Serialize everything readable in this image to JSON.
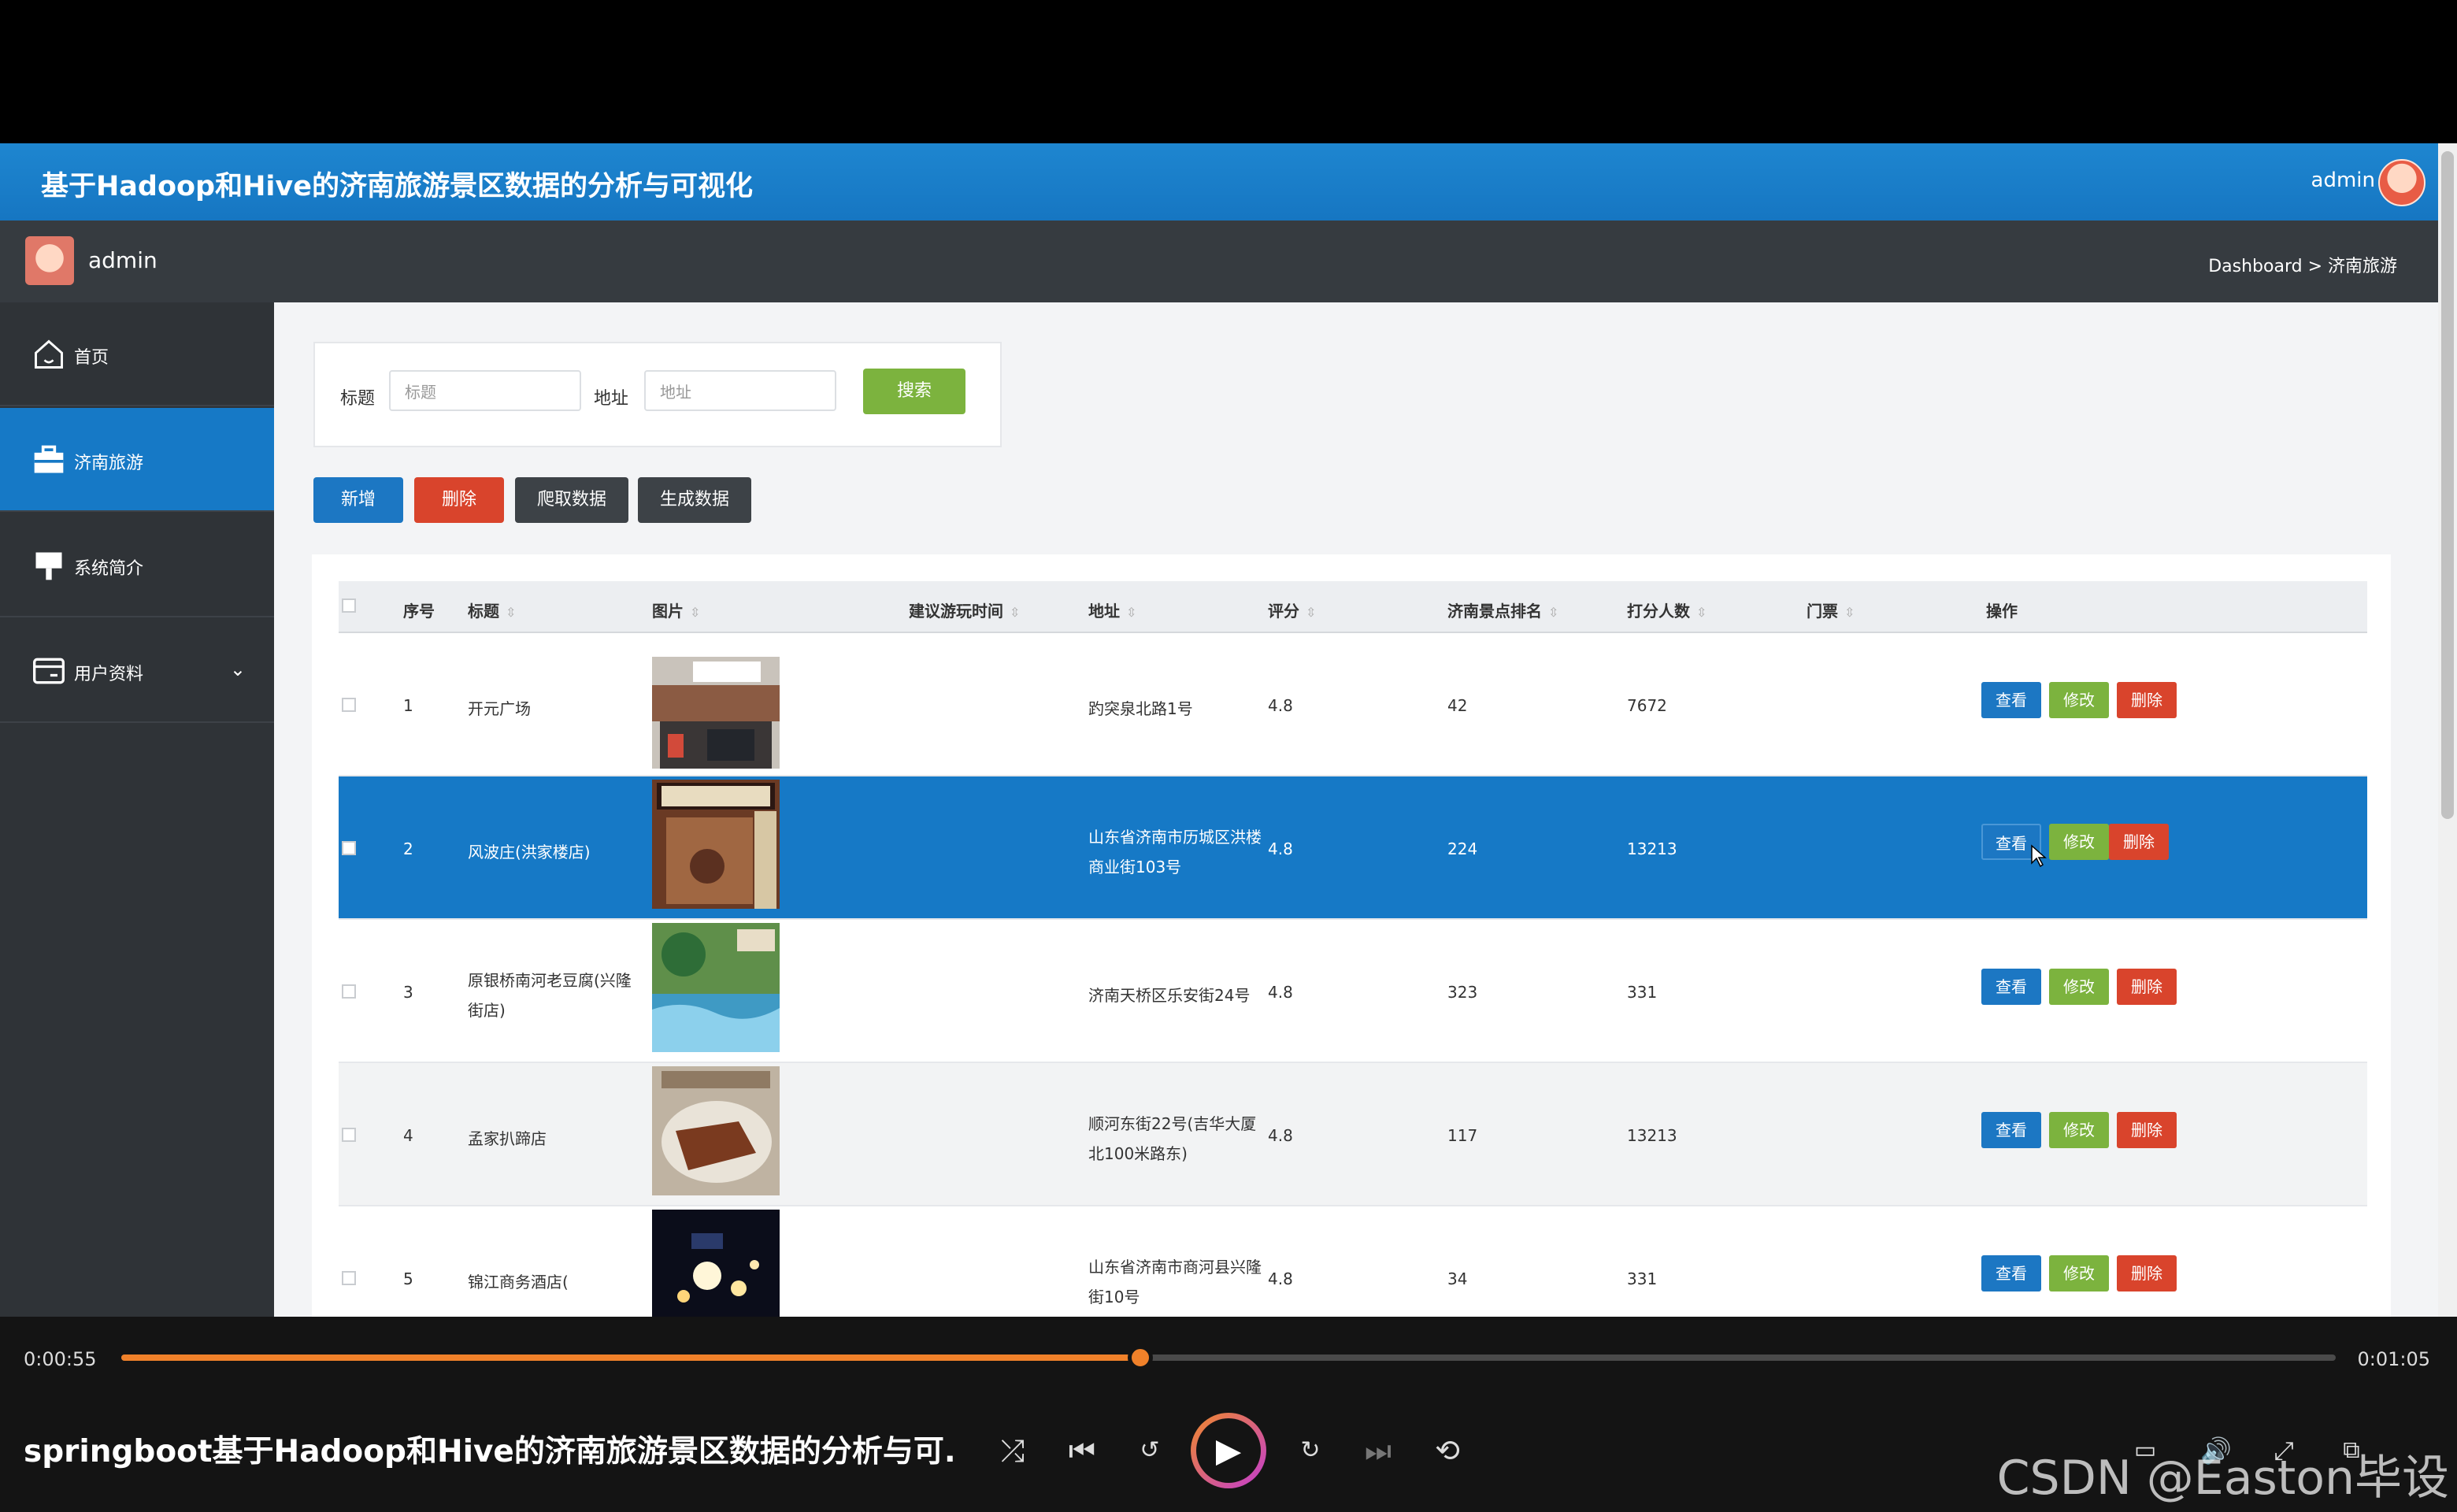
{
  "header": {
    "title": "基于Hadoop和Hive的济南旅游景区数据的分析与可视化",
    "user": "admin"
  },
  "subbar": {
    "user": "admin",
    "breadcrumb": "Dashboard > 济南旅游"
  },
  "sidebar": {
    "items": [
      {
        "label": "首页",
        "icon": "home-icon"
      },
      {
        "label": "济南旅游",
        "icon": "briefcase-icon",
        "active": true
      },
      {
        "label": "系统简介",
        "icon": "signpost-icon"
      },
      {
        "label": "用户资料",
        "icon": "id-card-icon",
        "expand": "⌄"
      }
    ]
  },
  "search": {
    "title_label": "标题",
    "title_placeholder": "标题",
    "address_label": "地址",
    "address_placeholder": "地址",
    "search_button": "搜索"
  },
  "toolbar": {
    "add": "新增",
    "delete": "删除",
    "crawl": "爬取数据",
    "generate": "生成数据"
  },
  "table": {
    "columns": [
      "序号",
      "标题",
      "图片",
      "建议游玩时间",
      "地址",
      "评分",
      "济南景点排名",
      "打分人数",
      "门票",
      "操作"
    ],
    "action_labels": {
      "view": "查看",
      "edit": "修改",
      "delete": "删除"
    },
    "rows": [
      {
        "no": "1",
        "title": "开元广场",
        "address": "趵突泉北路1号",
        "rating": "4.8",
        "rank": "42",
        "votes": "7672",
        "image": "plaza-photo"
      },
      {
        "no": "2",
        "title": "风波庄(洪家楼店)",
        "address": "山东省济南市历城区洪楼商业街103号",
        "rating": "4.8",
        "rank": "224",
        "votes": "13213",
        "image": "restaurant-photo",
        "selected": true
      },
      {
        "no": "3",
        "title": "原银桥南河老豆腐(兴隆街店)",
        "address": "济南天桥区乐安街24号",
        "rating": "4.8",
        "rank": "323",
        "votes": "331",
        "image": "spring-photo"
      },
      {
        "no": "4",
        "title": "孟家扒蹄店",
        "address": "顺河东街22号(吉华大厦北100米路东)",
        "rating": "4.8",
        "rank": "117",
        "votes": "13213",
        "image": "food-photo"
      },
      {
        "no": "5",
        "title": "锦江商务酒店(",
        "address": "山东省济南市商河县兴隆街10号",
        "rating": "4.8",
        "rank": "34",
        "votes": "331",
        "image": "night-photo"
      }
    ]
  },
  "player": {
    "current_time": "0:00:55",
    "total_time": "0:01:05",
    "progress": 0.46,
    "video_title": "springboot基于Hadoop和Hive的济南旅游景区数据的分析与可...",
    "watermark": "CSDN @Easton毕设",
    "accent_color": "#f0812a"
  },
  "colors": {
    "primary": "#1679c6",
    "danger": "#d9442c",
    "success": "#7cb33e",
    "sidebar": "#2f3337"
  }
}
